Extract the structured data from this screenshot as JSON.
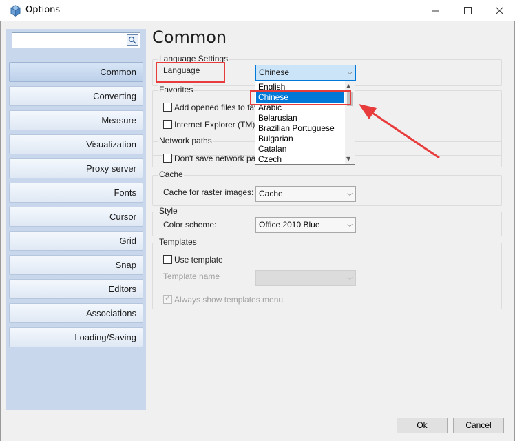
{
  "window": {
    "title": "Options",
    "icon": "app-cube-icon"
  },
  "nav": {
    "search_placeholder": "",
    "items": [
      {
        "label": "Common",
        "selected": true
      },
      {
        "label": "Converting"
      },
      {
        "label": "Measure"
      },
      {
        "label": "Visualization"
      },
      {
        "label": "Proxy server"
      },
      {
        "label": "Fonts"
      },
      {
        "label": "Cursor"
      },
      {
        "label": "Grid"
      },
      {
        "label": "Snap"
      },
      {
        "label": "Editors"
      },
      {
        "label": "Associations"
      },
      {
        "label": "Loading/Saving"
      }
    ]
  },
  "content": {
    "title": "Common",
    "language_settings": {
      "group_label": "Language Settings",
      "language_label": "Language",
      "language_value": "Chinese",
      "options": [
        "English",
        "Chinese",
        "Arabic",
        "Belarusian",
        "Brazilian Portuguese",
        "Bulgarian",
        "Catalan",
        "Czech"
      ],
      "selected_option": "Chinese"
    },
    "favorites": {
      "group_label": "Favorites",
      "add_opened_files": "Add opened files to fav",
      "internet_explorer": "Internet Explorer (TM)"
    },
    "network_paths": {
      "group_label": "Network paths",
      "dont_save": "Don't save network pat"
    },
    "cache": {
      "group_label": "Cache",
      "label": "Cache for raster images:",
      "value": "Cache"
    },
    "style": {
      "group_label": "Style",
      "label": "Color scheme:",
      "value": "Office 2010 Blue"
    },
    "templates": {
      "group_label": "Templates",
      "use_template": "Use template",
      "template_name_label": "Template name",
      "template_name_value": "",
      "always_show": "Always show templates menu",
      "always_show_checked": true
    }
  },
  "footer": {
    "ok": "Ok",
    "cancel": "Cancel"
  },
  "colors": {
    "annotation": "#e83b3b",
    "selection": "#0078d7",
    "nav_background": "#c8d7ec"
  }
}
